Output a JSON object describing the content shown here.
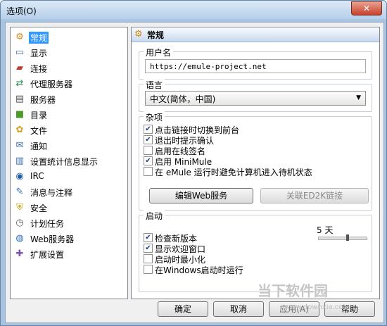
{
  "window": {
    "title": "选项(O)",
    "close_glyph": "✕"
  },
  "nav": {
    "items": [
      {
        "label": "常规",
        "icon": "gear-icon",
        "glyph": "⚙",
        "color": "#d08a10"
      },
      {
        "label": "显示",
        "icon": "display-icon",
        "glyph": "▭",
        "color": "#3a6fb0"
      },
      {
        "label": "连接",
        "icon": "connection-icon",
        "glyph": "▰",
        "color": "#c0392b"
      },
      {
        "label": "代理服务器",
        "icon": "proxy-icon",
        "glyph": "⇄",
        "color": "#2e8b57"
      },
      {
        "label": "服务器",
        "icon": "server-icon",
        "glyph": "▤",
        "color": "#555555"
      },
      {
        "label": "目录",
        "icon": "folder-icon",
        "glyph": "■",
        "color": "#4c9a2a"
      },
      {
        "label": "文件",
        "icon": "file-icon",
        "glyph": "✿",
        "color": "#d4a017"
      },
      {
        "label": "通知",
        "icon": "notify-icon",
        "glyph": "✉",
        "color": "#3a6fb0"
      },
      {
        "label": "设置统计信息显示",
        "icon": "stats-icon",
        "glyph": "▥",
        "color": "#3a6fb0"
      },
      {
        "label": "IRC",
        "icon": "irc-icon",
        "glyph": "◉",
        "color": "#1f5fa8"
      },
      {
        "label": "消息与注释",
        "icon": "message-icon",
        "glyph": "✎",
        "color": "#3a6fb0"
      },
      {
        "label": "安全",
        "icon": "shield-icon",
        "glyph": "⛨",
        "color": "#c99a0c"
      },
      {
        "label": "计划任务",
        "icon": "schedule-icon",
        "glyph": "◷",
        "color": "#555555"
      },
      {
        "label": "Web服务器",
        "icon": "web-server-icon",
        "glyph": "◍",
        "color": "#2e6fb0"
      },
      {
        "label": "扩展设置",
        "icon": "extension-icon",
        "glyph": "✚",
        "color": "#7a4fb0"
      }
    ],
    "selected_index": 0
  },
  "panel": {
    "header_title": "常规",
    "header_icon": "gear-icon",
    "nickname": {
      "group_title": "用户名",
      "value": "https://emule-project.net"
    },
    "language": {
      "group_title": "语言",
      "selected": "中文(简体，中国)"
    },
    "misc": {
      "group_title": "杂项",
      "options": [
        {
          "label": "点击链接时切换到前台",
          "checked": true
        },
        {
          "label": "退出时提示确认",
          "checked": true
        },
        {
          "label": "启用在线签名",
          "checked": false
        },
        {
          "label": "启用 MiniMule",
          "checked": true
        },
        {
          "label": "在 eMule 运行时避免计算机进入待机状态",
          "checked": false
        }
      ],
      "edit_web_button": "编辑Web服务",
      "ed2k_button": "关联ED2K链接"
    },
    "startup": {
      "group_title": "启动",
      "options": [
        {
          "label": "检查新版本",
          "checked": true
        },
        {
          "label": "显示欢迎窗口",
          "checked": true
        },
        {
          "label": "启动时最小化",
          "checked": false
        },
        {
          "label": "在Windows启动时运行",
          "checked": false
        }
      ],
      "days_label": "5 天",
      "days_value": 5
    }
  },
  "buttons": {
    "ok": "确定",
    "cancel": "取消",
    "apply": "应用(A)",
    "help": "帮助"
  },
  "watermark": {
    "text": "当下软件园",
    "url": "www.downxia.com"
  }
}
